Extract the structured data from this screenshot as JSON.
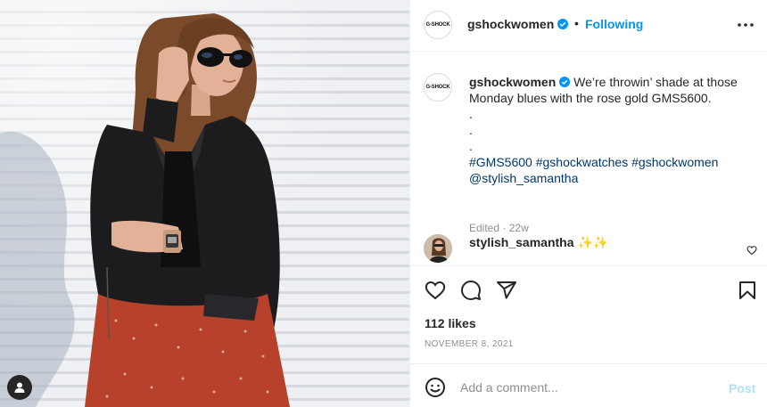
{
  "post": {
    "username": "gshockwomen",
    "follow_status": "Following",
    "header_separator": "•",
    "logo_text": "G-SHOCK",
    "caption": {
      "username": "gshockwomen",
      "text_line1": "We’re throwin’ shade at those",
      "text_line2": "Monday blues with the rose gold GMS5600.",
      "dots": [
        ".",
        ".",
        "."
      ],
      "hashtags": [
        "#GMS5600",
        "#gshockwatches",
        "#gshockwomen"
      ],
      "mention": "@stylish_samantha",
      "edited_label": "Edited",
      "meta_separator": "·",
      "age": "22w"
    },
    "comments": [
      {
        "username": "stylish_samantha",
        "text": "✨✨"
      }
    ],
    "likes": "112 likes",
    "date": "NOVEMBER 8, 2021",
    "comment_placeholder": "Add a comment...",
    "post_label": "Post"
  },
  "icons": {
    "verified": "verified-badge-icon",
    "more": "more-options-icon",
    "like": "heart-icon",
    "comment": "comment-bubble-icon",
    "share": "paper-plane-icon",
    "save": "bookmark-icon",
    "emoji": "emoji-smile-icon",
    "tagged_users": "user-tag-icon"
  },
  "colors": {
    "accent_blue": "#0095f6",
    "link_blue": "#00376b",
    "muted_text": "#8e8e8e",
    "post_disabled": "#b2dffc",
    "text": "#262626"
  }
}
